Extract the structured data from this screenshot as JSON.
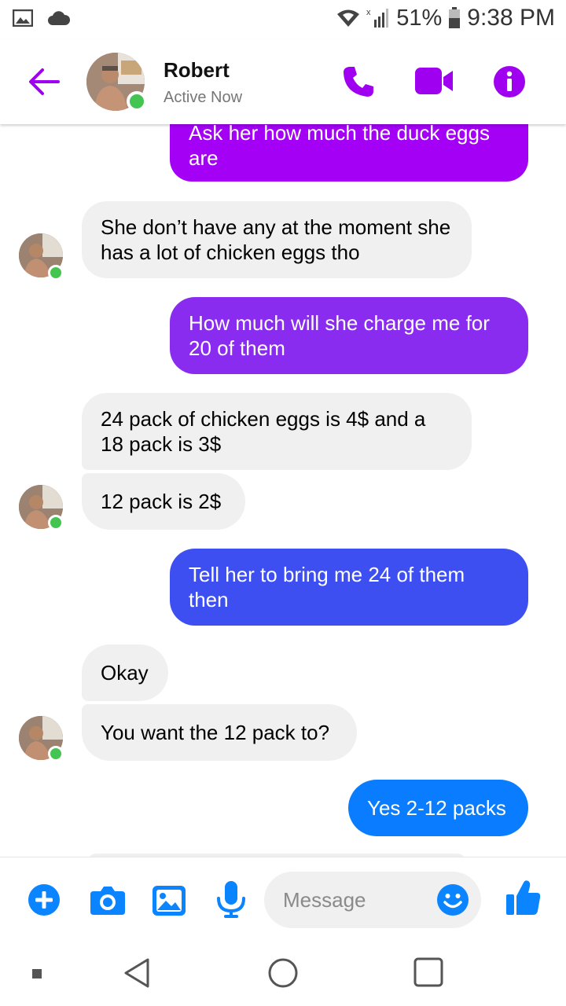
{
  "status_bar": {
    "battery": "51%",
    "time": "9:38 PM"
  },
  "header": {
    "contact_name": "Robert",
    "contact_status": "Active Now"
  },
  "messages": [
    {
      "side": "out",
      "text": "Ask her how much the duck eggs are",
      "color": "#a300f5"
    },
    {
      "side": "in",
      "text": "She don’t have any at the moment she has a lot of chicken eggs tho"
    },
    {
      "side": "out",
      "text": "How much will she charge me for 20 of them",
      "color": "#8a2bf0"
    },
    {
      "side": "in",
      "text": "24 pack of chicken eggs is 4$ and a 18 pack is 3$"
    },
    {
      "side": "in",
      "text": "12 pack is 2$"
    },
    {
      "side": "out",
      "text": "Tell her to bring me 24 of them then",
      "color": "#3e4ff2"
    },
    {
      "side": "in",
      "text": "Okay"
    },
    {
      "side": "in",
      "text": "You want the 12 pack to?"
    },
    {
      "side": "out",
      "text": "Yes 2-12 packs",
      "color": "#0a7cff"
    }
  ],
  "composer": {
    "placeholder": "Message"
  },
  "colors": {
    "accent": "#a000f0",
    "composer_blue": "#0a84ff",
    "presence": "#44c451"
  },
  "icons": {
    "header": [
      "back-arrow-icon",
      "phone-icon",
      "video-camera-icon",
      "info-icon"
    ],
    "composer": [
      "plus-icon",
      "camera-icon",
      "gallery-icon",
      "microphone-icon",
      "emoji-icon",
      "thumbs-up-icon"
    ],
    "nav": [
      "recent-apps-square-icon",
      "back-triangle-icon",
      "home-circle-icon",
      "overview-square-icon"
    ]
  }
}
